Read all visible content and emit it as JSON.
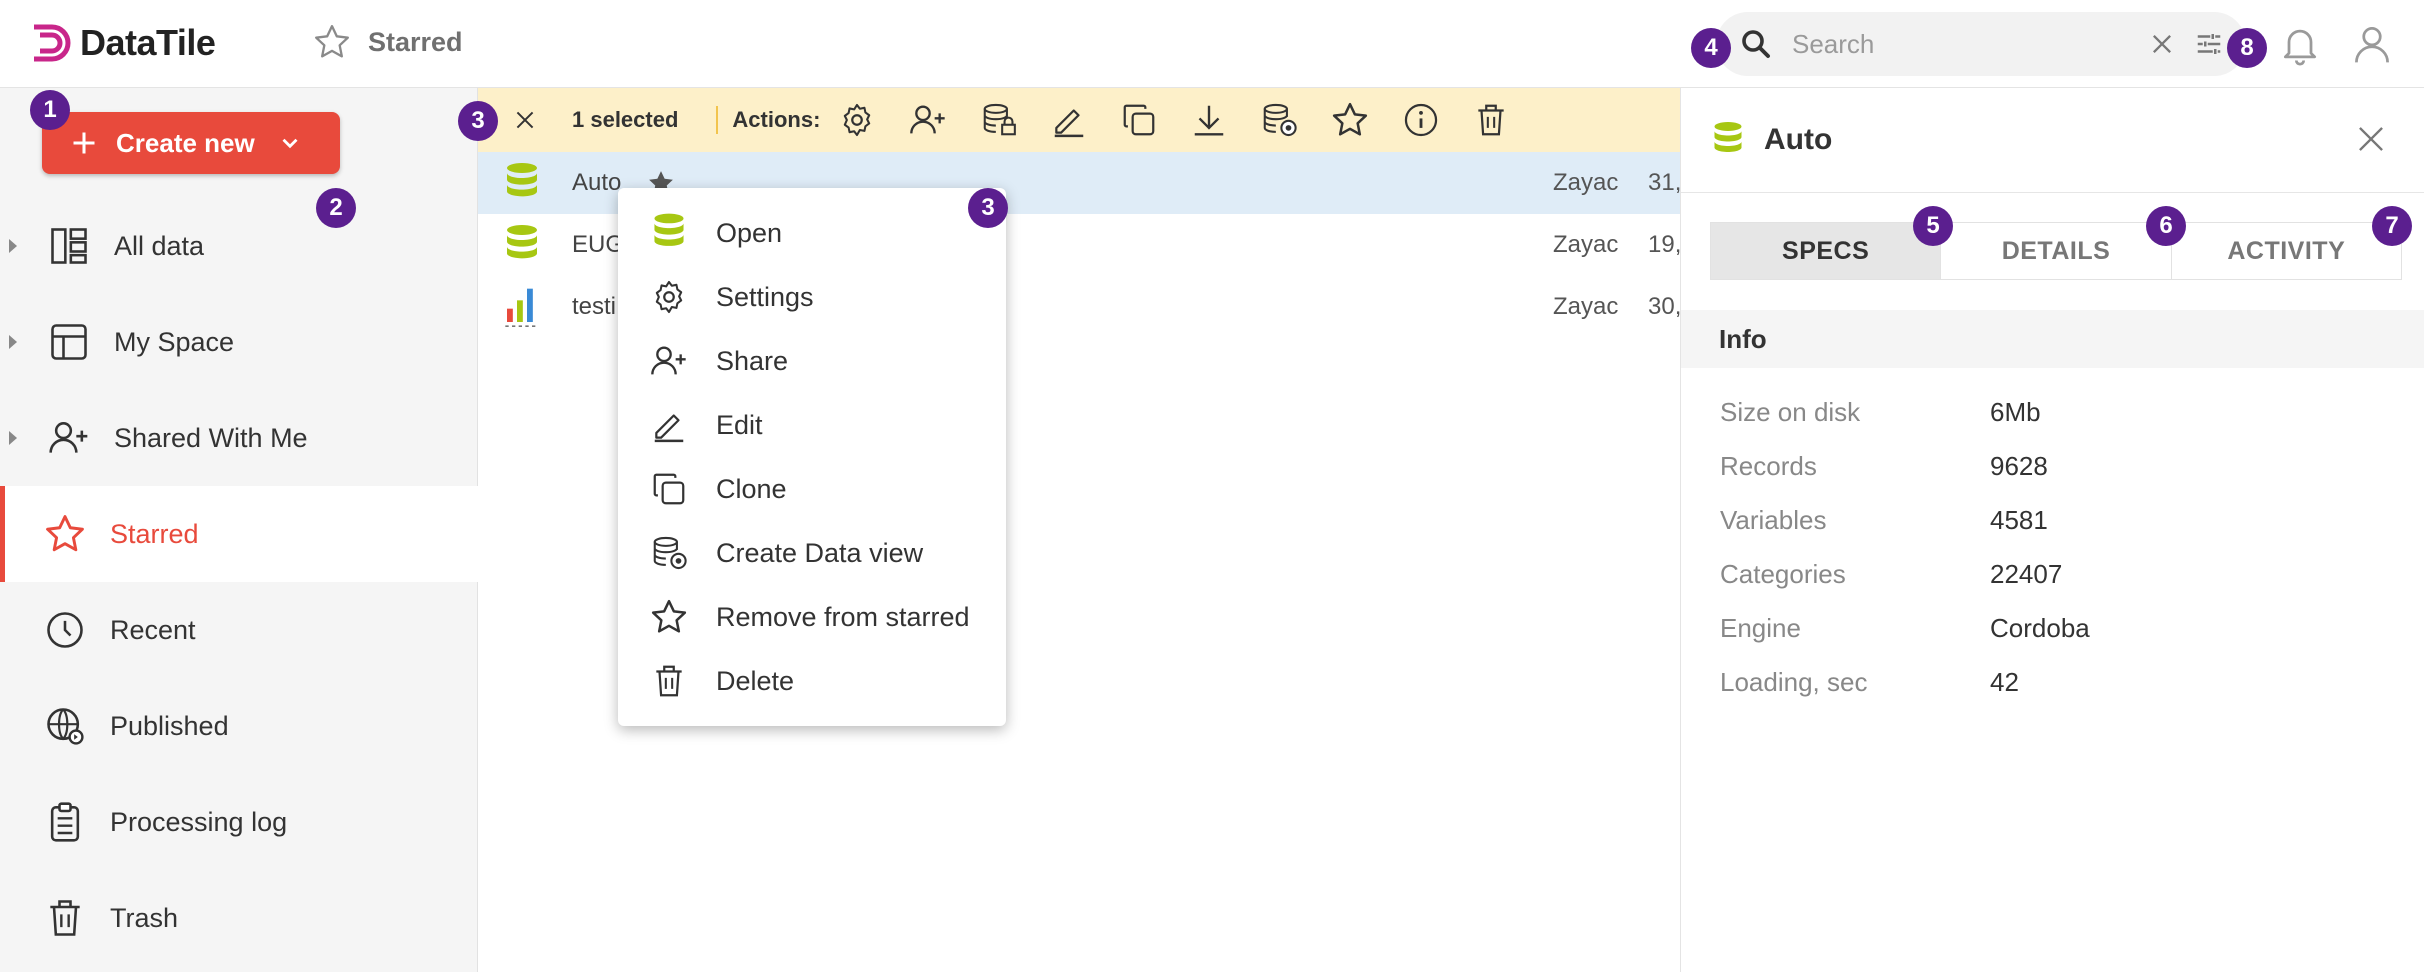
{
  "app": {
    "name": "DataTile"
  },
  "header": {
    "breadcrumb": "Starred",
    "search_placeholder": "Search",
    "search_value": ""
  },
  "sidebar": {
    "create_label": "Create new",
    "items": [
      {
        "label": "All data",
        "icon": "dashboard-icon",
        "expandable": true
      },
      {
        "label": "My Space",
        "icon": "layout-icon",
        "expandable": true
      },
      {
        "label": "Shared With Me",
        "icon": "person-add-icon",
        "expandable": true
      },
      {
        "label": "Starred",
        "icon": "star-icon",
        "active": true
      },
      {
        "label": "Recent",
        "icon": "clock-icon"
      },
      {
        "label": "Published",
        "icon": "globe-icon"
      },
      {
        "label": "Processing log",
        "icon": "clipboard-icon"
      },
      {
        "label": "Trash",
        "icon": "trash-icon"
      }
    ]
  },
  "selection_bar": {
    "count_label": "1 selected",
    "actions_label": "Actions:",
    "tools": [
      "settings-icon",
      "share-icon",
      "lock-database-icon",
      "edit-icon",
      "clone-icon",
      "download-icon",
      "data-view-icon",
      "star-icon",
      "info-icon",
      "trash-icon"
    ]
  },
  "rows": [
    {
      "name": "Auto",
      "owner": "Zayac",
      "date": "31,",
      "icon": "database-icon",
      "selected": true,
      "starred": true
    },
    {
      "name": "EUG",
      "owner": "Zayac",
      "date": "19,",
      "icon": "database-icon"
    },
    {
      "name": "testi",
      "owner": "Zayac",
      "date": "30,",
      "icon": "bar-chart-icon"
    }
  ],
  "context_menu": {
    "items": [
      {
        "label": "Open",
        "icon": "database-icon"
      },
      {
        "label": "Settings",
        "icon": "settings-icon"
      },
      {
        "label": "Share",
        "icon": "share-icon"
      },
      {
        "label": "Edit",
        "icon": "edit-icon"
      },
      {
        "label": "Clone",
        "icon": "clone-icon"
      },
      {
        "label": "Create Data view",
        "icon": "data-view-icon"
      },
      {
        "label": "Remove from starred",
        "icon": "star-icon"
      },
      {
        "label": "Delete",
        "icon": "trash-icon"
      }
    ]
  },
  "details_panel": {
    "title": "Auto",
    "tabs": [
      "SPECS",
      "DETAILS",
      "ACTIVITY"
    ],
    "active_tab": "SPECS",
    "section_title": "Info",
    "specs": [
      {
        "key": "Size on disk",
        "value": "6Mb"
      },
      {
        "key": "Records",
        "value": "9628"
      },
      {
        "key": "Variables",
        "value": "4581"
      },
      {
        "key": "Categories",
        "value": "22407"
      },
      {
        "key": "Engine",
        "value": "Cordoba"
      },
      {
        "key": "Loading, sec",
        "value": "42"
      }
    ]
  },
  "annotations": [
    "1",
    "2",
    "3",
    "3",
    "4",
    "5",
    "6",
    "7",
    "8"
  ],
  "colors": {
    "accent": "#e84a3c",
    "selection_bar": "#fdf0c9",
    "selected_row": "#dfecf7",
    "badge": "#5b1f8f",
    "database_icon": "#a7c712"
  }
}
